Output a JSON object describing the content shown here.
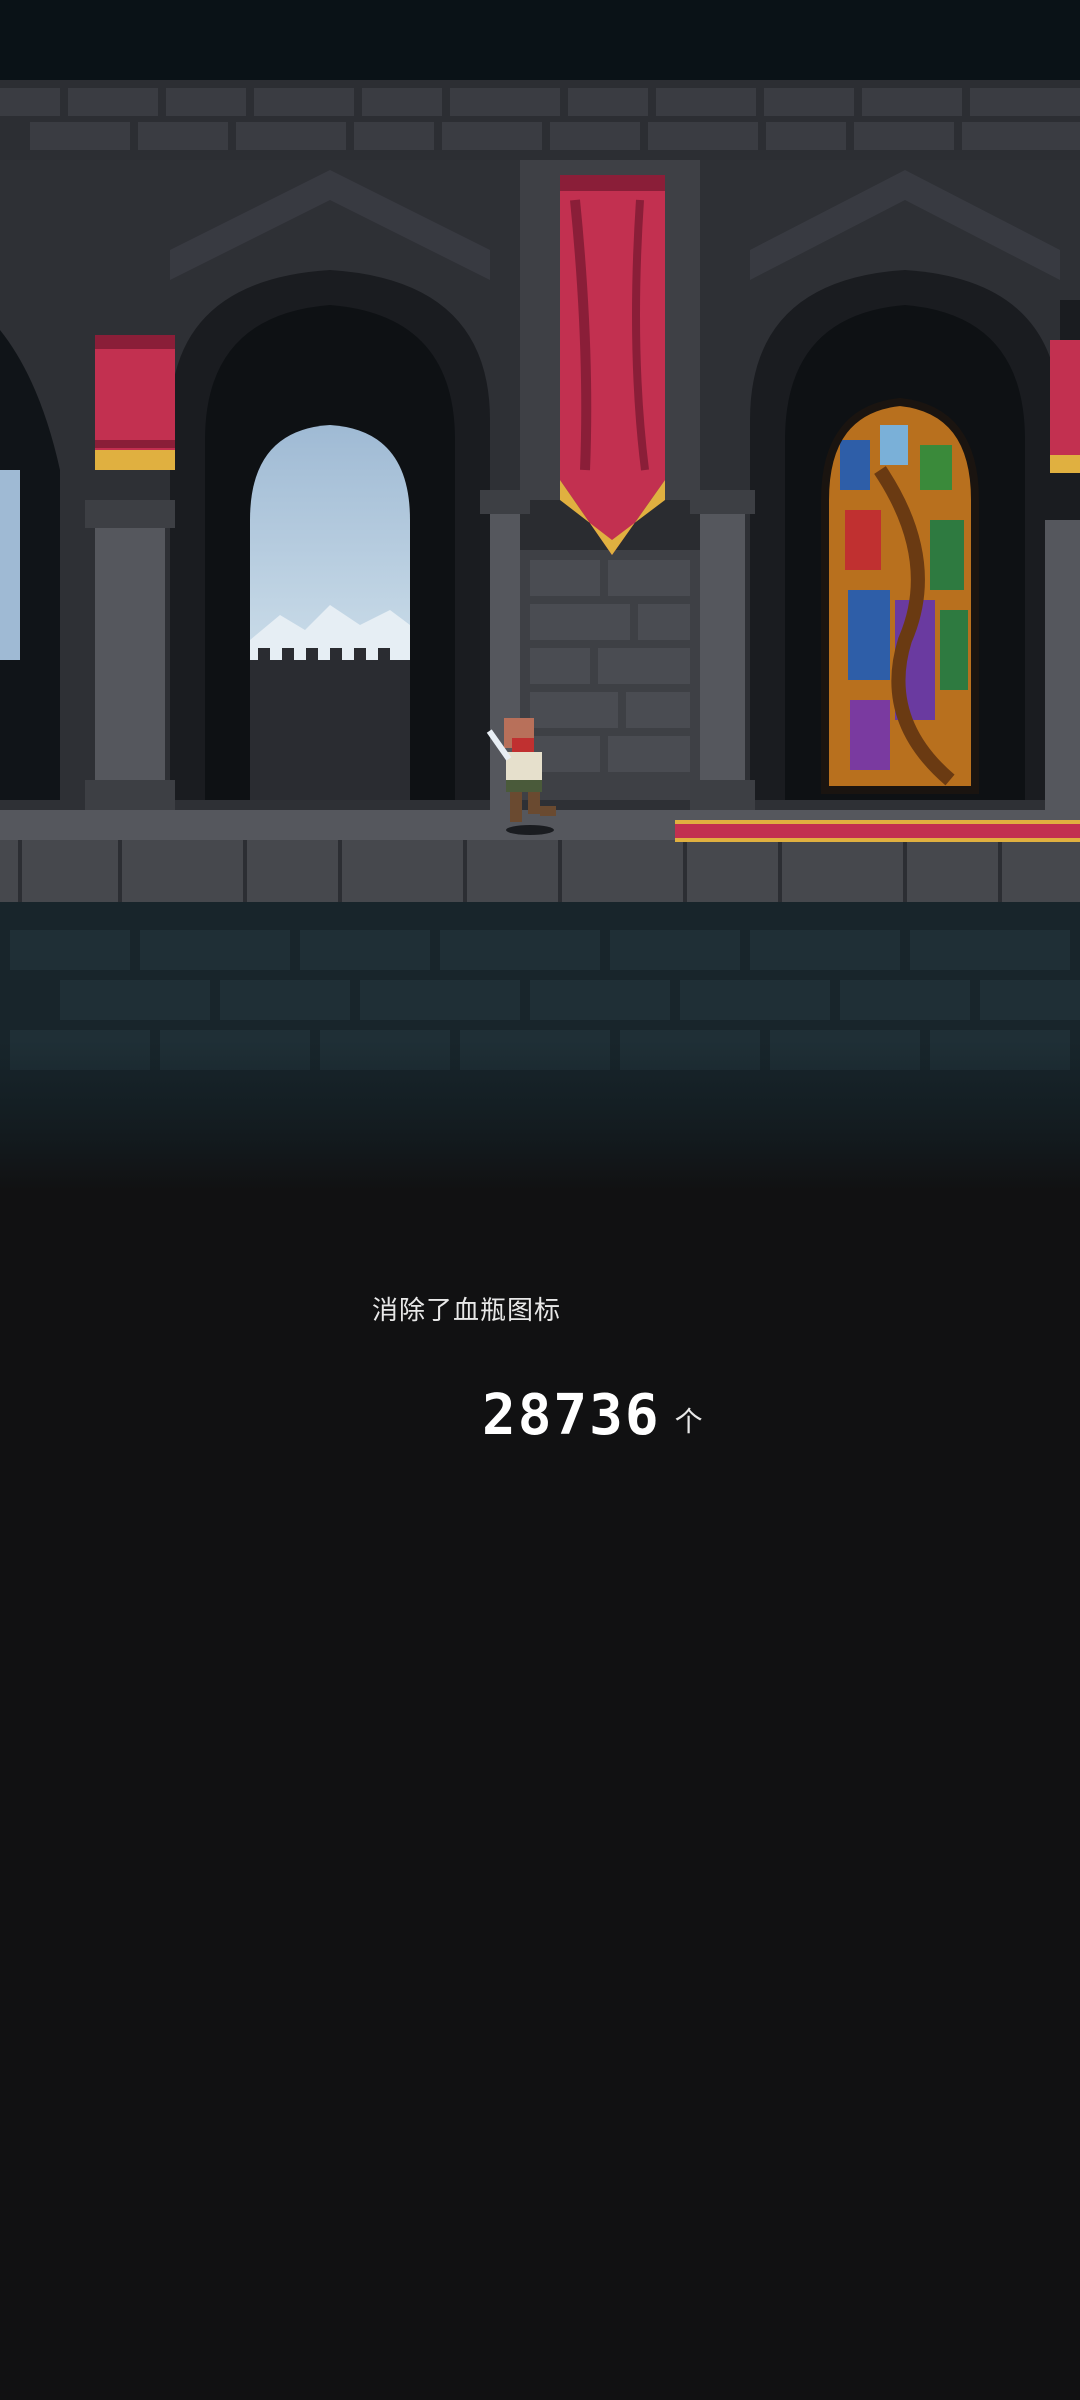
{
  "scene": {
    "colors": {
      "sky_top": "#0a1217",
      "wall": "#3a3c42",
      "wall_dark": "#26282d",
      "banner": "#c23050",
      "banner_trim": "#e0b040",
      "floor": "#46484d",
      "foundation": "#18252b",
      "window_sky": "#b8d0e4",
      "background": "#111112"
    }
  },
  "stats": {
    "label": "消除了血瓶图标",
    "value": "28736",
    "unit": "个"
  }
}
